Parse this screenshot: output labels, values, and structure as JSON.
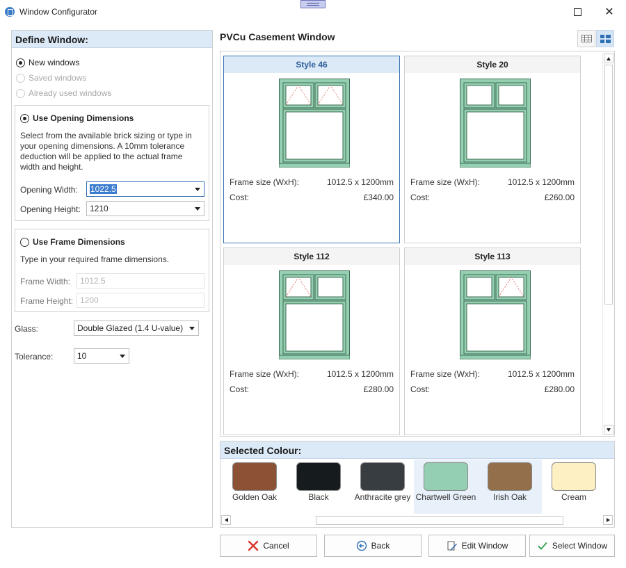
{
  "window": {
    "title": "Window Configurator",
    "minimize": "—",
    "close": "✕"
  },
  "left": {
    "header": "Define Window:",
    "sources": [
      {
        "label": "New windows",
        "checked": true,
        "enabled": true
      },
      {
        "label": "Saved windows",
        "checked": false,
        "enabled": false
      },
      {
        "label": "Already used windows",
        "checked": false,
        "enabled": false
      }
    ],
    "opening": {
      "title": "Use Opening Dimensions",
      "help": [
        "Select from the available brick sizing or type in",
        "your opening dimensions. A 10mm tolerance",
        "deduction will be applied to the actual frame",
        "width and height."
      ],
      "width_label": "Opening Width:",
      "width_value": "1022.5",
      "height_label": "Opening Height:",
      "height_value": "1210"
    },
    "frame": {
      "title": "Use Frame Dimensions",
      "help": "Type in your required frame dimensions.",
      "width_label": "Frame Width:",
      "width_placeholder": "1012.5",
      "height_label": "Frame Height:",
      "height_placeholder": "1200"
    },
    "glass": {
      "label": "Glass:",
      "value": "Double Glazed  (1.4 U-value)"
    },
    "tolerance": {
      "label": "Tolerance:",
      "value": "10"
    }
  },
  "main": {
    "title": "PVCu Casement Window",
    "view_buttons": [
      {
        "icon": "grid-view-icon"
      },
      {
        "icon": "tile-view-icon",
        "active": true
      }
    ],
    "styles": [
      {
        "name": "Style 46",
        "frame_label": "Frame size (WxH):",
        "frame_size": "1012.5 x 1200mm",
        "cost_label": "Cost:",
        "cost": "£340.00",
        "selected": true,
        "vents": "both"
      },
      {
        "name": "Style 20",
        "frame_label": "Frame size (WxH):",
        "frame_size": "1012.5 x 1200mm",
        "cost_label": "Cost:",
        "cost": "£260.00",
        "selected": false,
        "vents": "none"
      },
      {
        "name": "Style 112",
        "frame_label": "Frame size (WxH):",
        "frame_size": "1012.5 x 1200mm",
        "cost_label": "Cost:",
        "cost": "£280.00",
        "selected": false,
        "vents": "left"
      },
      {
        "name": "Style 113",
        "frame_label": "Frame size (WxH):",
        "frame_size": "1012.5 x 1200mm",
        "cost_label": "Cost:",
        "cost": "£280.00",
        "selected": false,
        "vents": "right"
      }
    ]
  },
  "colour": {
    "header": "Selected Colour:",
    "swatches": [
      {
        "label": "Golden Oak",
        "color": "#8b5235"
      },
      {
        "label": "Black",
        "color": "#161c1e"
      },
      {
        "label": "Anthracite grey",
        "color": "#383d42"
      },
      {
        "label": "Chartwell Green",
        "color": "#93cfb0",
        "highlight": true
      },
      {
        "label": "Irish Oak",
        "color": "#93704b",
        "highlight": true
      },
      {
        "label": "Cream",
        "color": "#fdf1c4"
      }
    ]
  },
  "actions": {
    "cancel": "Cancel",
    "back": "Back",
    "edit": "Edit Window",
    "select": "Select Window"
  },
  "colors": {
    "frame_green": "#93cfb0",
    "accent_blue": "#3874b0",
    "header_bg": "#dce9f7"
  }
}
